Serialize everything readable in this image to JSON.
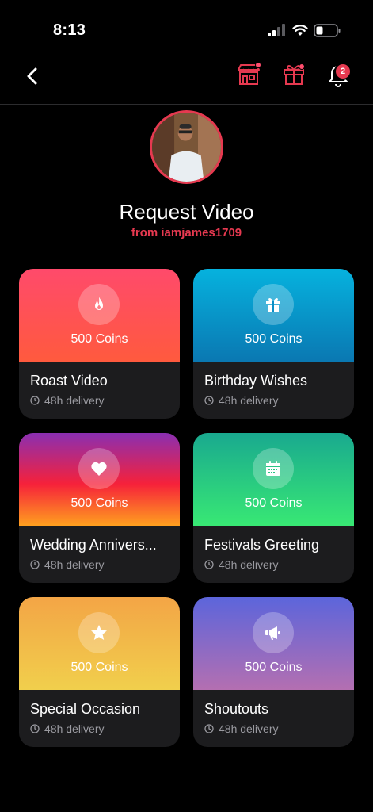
{
  "status_bar": {
    "time": "8:13"
  },
  "nav": {
    "notification_count": "2"
  },
  "profile": {
    "title": "Request Video",
    "subtitle": "from iamjames1709"
  },
  "cards": [
    {
      "name": "Roast Video",
      "coins": "500 Coins",
      "delivery": "48h delivery",
      "icon": "fire-icon"
    },
    {
      "name": "Birthday Wishes",
      "coins": "500 Coins",
      "delivery": "48h delivery",
      "icon": "gift-icon"
    },
    {
      "name": "Wedding Annivers...",
      "coins": "500 Coins",
      "delivery": "48h delivery",
      "icon": "heart-icon"
    },
    {
      "name": "Festivals Greeting",
      "coins": "500 Coins",
      "delivery": "48h delivery",
      "icon": "calendar-icon"
    },
    {
      "name": "Special Occasion",
      "coins": "500 Coins",
      "delivery": "48h delivery",
      "icon": "star-icon"
    },
    {
      "name": "Shoutouts",
      "coins": "500 Coins",
      "delivery": "48h delivery",
      "icon": "megaphone-icon"
    }
  ],
  "colors": {
    "accent": "#e63950",
    "background": "#000000",
    "card_bg": "#1c1c1e"
  }
}
